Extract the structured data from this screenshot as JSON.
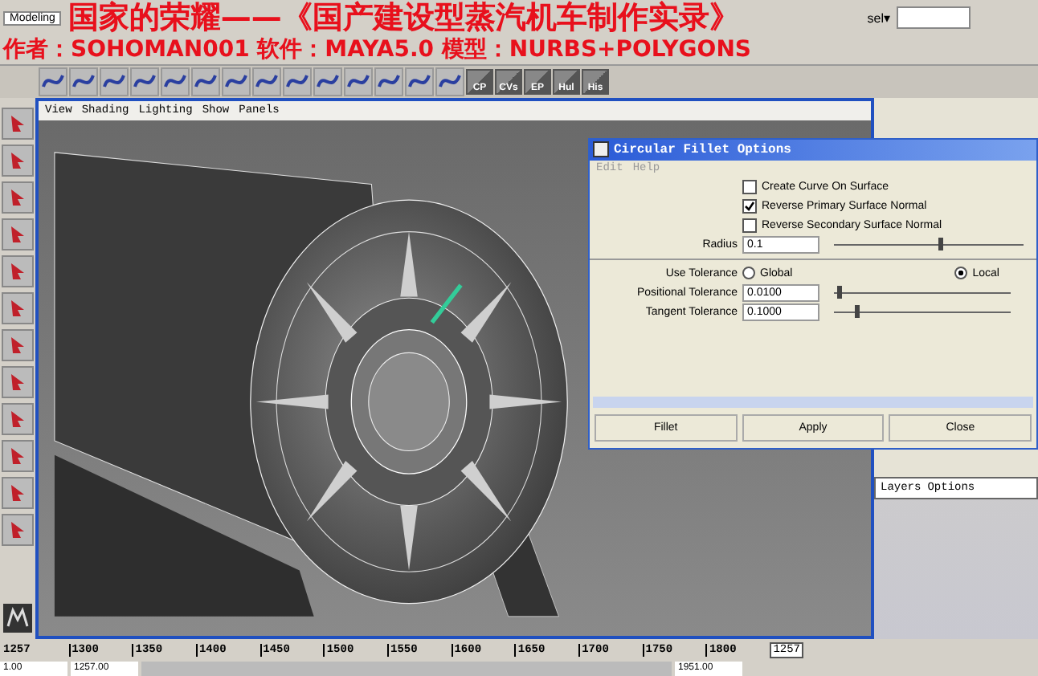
{
  "caption": {
    "title": "国家的荣耀——《国产建设型蒸汽机车制作实录》",
    "credits": "作者：SOHOMAN001 软件：MAYA5.0 模型：NURBS+POLYGONS"
  },
  "toolbar": {
    "mode": "Modeling",
    "selection_field_label": "sel▾"
  },
  "shelf": {
    "labeled_tools": [
      "CP",
      "CVs",
      "EP",
      "Hul",
      "His"
    ]
  },
  "viewport": {
    "panel_menu": [
      "View",
      "Shading",
      "Lighting",
      "Show",
      "Panels"
    ]
  },
  "dialog": {
    "title": "Circular Fillet Options",
    "menu": [
      "Edit",
      "Help"
    ],
    "checkboxes": [
      {
        "label": "Create Curve On Surface",
        "checked": false
      },
      {
        "label": "Reverse Primary Surface Normal",
        "checked": true
      },
      {
        "label": "Reverse Secondary Surface Normal",
        "checked": false
      }
    ],
    "radius": {
      "label": "Radius",
      "value": "0.1",
      "level": 0.55
    },
    "use_tolerance": {
      "label": "Use Tolerance",
      "options": [
        {
          "label": "Global",
          "selected": false
        },
        {
          "label": "Local",
          "selected": true
        }
      ]
    },
    "tolerances": [
      {
        "label": "Positional Tolerance",
        "value": "0.0100",
        "level": 0.02
      },
      {
        "label": "Tangent Tolerance",
        "value": "0.1000",
        "level": 0.12
      }
    ],
    "buttons": [
      "Fillet",
      "Apply",
      "Close"
    ]
  },
  "layer_editor": {
    "menu": [
      "Layers",
      "Options"
    ]
  },
  "time_slider": {
    "start": "1257",
    "ticks": [
      "1300",
      "1350",
      "1400",
      "1450",
      "1500",
      "1550",
      "1600",
      "1650",
      "1700",
      "1750",
      "1800"
    ],
    "current": "1257"
  },
  "range_slider": {
    "start": "1.00",
    "range_start": "1257.00",
    "end": "1951.00"
  }
}
